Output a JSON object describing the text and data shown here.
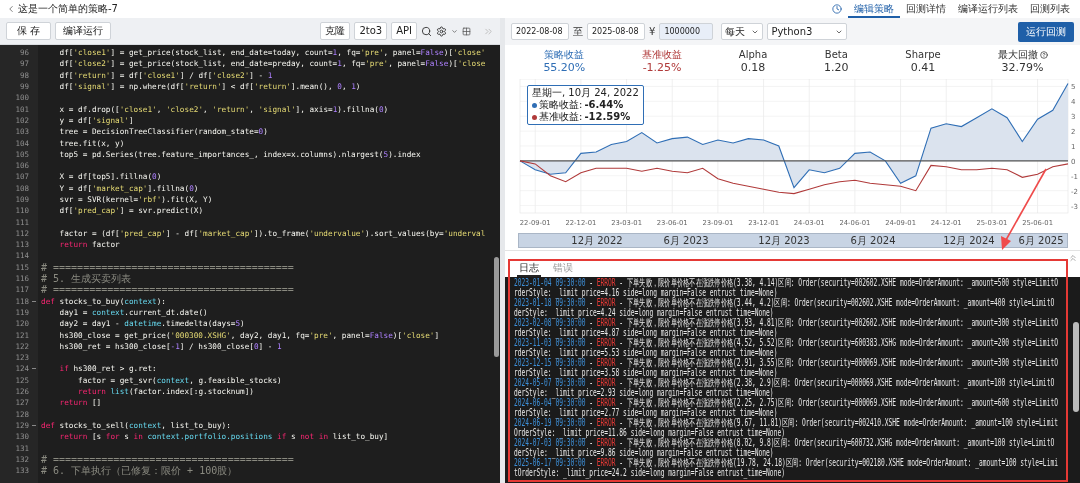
{
  "header": {
    "title": "这是一个简单的策略-7",
    "tabs": [
      {
        "label": "编辑策略",
        "selected": true
      },
      {
        "label": "回测详情",
        "selected": false
      },
      {
        "label": "编译运行列表",
        "selected": false
      },
      {
        "label": "回测列表",
        "selected": false
      }
    ]
  },
  "toolbar": {
    "save": "保 存",
    "compile": "编译运行",
    "tools": [
      "克隆",
      "2to3",
      "API"
    ]
  },
  "backtest": {
    "start_date": "2022-08-08",
    "range_sep": "至",
    "end_date": "2025-08-08",
    "currency": "¥",
    "capital": "1000000",
    "frequency": "每天",
    "language": "Python3",
    "run": "运行回测"
  },
  "code_lines": [
    {
      "num": "96",
      "fold": false,
      "tokens": [
        {
          "text": "    df[",
          "kind": "plain"
        },
        {
          "text": "'close1'",
          "kind": "string"
        },
        {
          "text": "] = get_price(stock_list, end_date=today, count=",
          "kind": "plain"
        },
        {
          "text": "1",
          "kind": "number"
        },
        {
          "text": ", fq=",
          "kind": "plain"
        },
        {
          "text": "'pre'",
          "kind": "string"
        },
        {
          "text": ", panel=",
          "kind": "plain"
        },
        {
          "text": "False",
          "kind": "number"
        },
        {
          "text": ")[",
          "kind": "plain"
        },
        {
          "text": "'close'",
          "kind": "string"
        }
      ]
    },
    {
      "num": "97",
      "fold": false,
      "tokens": [
        {
          "text": "    df[",
          "kind": "plain"
        },
        {
          "text": "'close2'",
          "kind": "string"
        },
        {
          "text": "] = get_price(stock_list, end_date=preday, count=",
          "kind": "plain"
        },
        {
          "text": "1",
          "kind": "number"
        },
        {
          "text": ", fq=",
          "kind": "plain"
        },
        {
          "text": "'pre'",
          "kind": "string"
        },
        {
          "text": ", panel=",
          "kind": "plain"
        },
        {
          "text": "False",
          "kind": "number"
        },
        {
          "text": ")[",
          "kind": "plain"
        },
        {
          "text": "'close",
          "kind": "string"
        }
      ]
    },
    {
      "num": "98",
      "fold": false,
      "tokens": [
        {
          "text": "    df[",
          "kind": "plain"
        },
        {
          "text": "'return'",
          "kind": "string"
        },
        {
          "text": "] = df[",
          "kind": "plain"
        },
        {
          "text": "'close1'",
          "kind": "string"
        },
        {
          "text": "] / df[",
          "kind": "plain"
        },
        {
          "text": "'close2'",
          "kind": "string"
        },
        {
          "text": "] - ",
          "kind": "plain"
        },
        {
          "text": "1",
          "kind": "number"
        }
      ]
    },
    {
      "num": "99",
      "fold": false,
      "tokens": [
        {
          "text": "    df[",
          "kind": "plain"
        },
        {
          "text": "'signal'",
          "kind": "string"
        },
        {
          "text": "] = np.where(df[",
          "kind": "plain"
        },
        {
          "text": "'return'",
          "kind": "string"
        },
        {
          "text": "] < df[",
          "kind": "plain"
        },
        {
          "text": "'return'",
          "kind": "string"
        },
        {
          "text": "].mean(), ",
          "kind": "plain"
        },
        {
          "text": "0",
          "kind": "number"
        },
        {
          "text": ", ",
          "kind": "plain"
        },
        {
          "text": "1",
          "kind": "number"
        },
        {
          "text": ")",
          "kind": "plain"
        }
      ]
    },
    {
      "num": "100",
      "fold": false
    },
    {
      "num": "101",
      "fold": false,
      "tokens": [
        {
          "text": "    x = df.drop([",
          "kind": "plain"
        },
        {
          "text": "'close1'",
          "kind": "string"
        },
        {
          "text": ", ",
          "kind": "plain"
        },
        {
          "text": "'close2'",
          "kind": "string"
        },
        {
          "text": ", ",
          "kind": "plain"
        },
        {
          "text": "'return'",
          "kind": "string"
        },
        {
          "text": ", ",
          "kind": "plain"
        },
        {
          "text": "'signal'",
          "kind": "string"
        },
        {
          "text": "], axis=",
          "kind": "plain"
        },
        {
          "text": "1",
          "kind": "number"
        },
        {
          "text": ").fillna(",
          "kind": "plain"
        },
        {
          "text": "0",
          "kind": "number"
        },
        {
          "text": ")",
          "kind": "plain"
        }
      ]
    },
    {
      "num": "102",
      "fold": false,
      "tokens": [
        {
          "text": "    y = df[",
          "kind": "plain"
        },
        {
          "text": "'signal'",
          "kind": "string"
        },
        {
          "text": "]",
          "kind": "plain"
        }
      ]
    },
    {
      "num": "103",
      "fold": false,
      "tokens": [
        {
          "text": "    tree = DecisionTreeClassifier(random_state=",
          "kind": "plain"
        },
        {
          "text": "0",
          "kind": "number"
        },
        {
          "text": ")",
          "kind": "plain"
        }
      ]
    },
    {
      "num": "104",
      "fold": false,
      "tokens": [
        {
          "text": "    tree.fit(x, y)",
          "kind": "plain"
        }
      ]
    },
    {
      "num": "105",
      "fold": false,
      "tokens": [
        {
          "text": "    top5 = pd.Series(tree.feature_importances_, index=x.columns).nlargest(",
          "kind": "plain"
        },
        {
          "text": "5",
          "kind": "number"
        },
        {
          "text": ").index",
          "kind": "plain"
        }
      ]
    },
    {
      "num": "106",
      "fold": false
    },
    {
      "num": "107",
      "fold": false,
      "tokens": [
        {
          "text": "    X = df[top5].fillna(",
          "kind": "plain"
        },
        {
          "text": "0",
          "kind": "number"
        },
        {
          "text": ")",
          "kind": "plain"
        }
      ]
    },
    {
      "num": "108",
      "fold": false,
      "tokens": [
        {
          "text": "    Y = df[",
          "kind": "plain"
        },
        {
          "text": "'market_cap'",
          "kind": "string"
        },
        {
          "text": "].fillna(",
          "kind": "plain"
        },
        {
          "text": "0",
          "kind": "number"
        },
        {
          "text": ")",
          "kind": "plain"
        }
      ]
    },
    {
      "num": "109",
      "fold": false,
      "tokens": [
        {
          "text": "    svr = SVR(kernel=",
          "kind": "plain"
        },
        {
          "text": "'rbf'",
          "kind": "string"
        },
        {
          "text": ").fit(X, Y)",
          "kind": "plain"
        }
      ]
    },
    {
      "num": "110",
      "fold": false,
      "tokens": [
        {
          "text": "    df[",
          "kind": "plain"
        },
        {
          "text": "'pred_cap'",
          "kind": "string"
        },
        {
          "text": "] = svr.predict(X)",
          "kind": "plain"
        }
      ]
    },
    {
      "num": "111",
      "fold": false
    },
    {
      "num": "112",
      "fold": false,
      "tokens": [
        {
          "text": "    factor = (df[",
          "kind": "plain"
        },
        {
          "text": "'pred_cap'",
          "kind": "string"
        },
        {
          "text": "] - df[",
          "kind": "plain"
        },
        {
          "text": "'market_cap'",
          "kind": "string"
        },
        {
          "text": "]).to_frame(",
          "kind": "plain"
        },
        {
          "text": "'undervalue'",
          "kind": "string"
        },
        {
          "text": ").sort_values(by=",
          "kind": "plain"
        },
        {
          "text": "'underval",
          "kind": "string"
        }
      ]
    },
    {
      "num": "113",
      "fold": false,
      "tokens": [
        {
          "text": "    return",
          "kind": "keyword"
        },
        {
          "text": " factor",
          "kind": "plain"
        }
      ]
    },
    {
      "num": "114",
      "fold": false
    },
    {
      "num": "115",
      "fold": false,
      "tokens": [
        {
          "text": "# ========================================",
          "kind": "comment"
        }
      ]
    },
    {
      "num": "116",
      "fold": false,
      "tokens": [
        {
          "text": "# 5. 生成买卖列表",
          "kind": "comment"
        }
      ]
    },
    {
      "num": "117",
      "fold": false,
      "tokens": [
        {
          "text": "# ========================================",
          "kind": "comment"
        }
      ]
    },
    {
      "num": "118",
      "fold": true,
      "tokens": [
        {
          "text": "def",
          "kind": "keyword"
        },
        {
          "text": " stocks_to_buy(",
          "kind": "plain"
        },
        {
          "text": "context",
          "kind": "builtin"
        },
        {
          "text": "):",
          "kind": "plain"
        }
      ]
    },
    {
      "num": "119",
      "fold": false,
      "tokens": [
        {
          "text": "    day1 = ",
          "kind": "plain"
        },
        {
          "text": "context",
          "kind": "builtin"
        },
        {
          "text": ".current_dt.date()",
          "kind": "plain"
        }
      ]
    },
    {
      "num": "120",
      "fold": false,
      "tokens": [
        {
          "text": "    day2 = day1 - ",
          "kind": "plain"
        },
        {
          "text": "datetime",
          "kind": "builtin"
        },
        {
          "text": ".timedelta(days=",
          "kind": "plain"
        },
        {
          "text": "5",
          "kind": "number"
        },
        {
          "text": ")",
          "kind": "plain"
        }
      ]
    },
    {
      "num": "121",
      "fold": false,
      "tokens": [
        {
          "text": "    hs300_close = get_price(",
          "kind": "plain"
        },
        {
          "text": "'000300.XSHG'",
          "kind": "string"
        },
        {
          "text": ", day2, day1, fq=",
          "kind": "plain"
        },
        {
          "text": "'pre'",
          "kind": "string"
        },
        {
          "text": ", panel=",
          "kind": "plain"
        },
        {
          "text": "False",
          "kind": "number"
        },
        {
          "text": ")[",
          "kind": "plain"
        },
        {
          "text": "'close'",
          "kind": "string"
        },
        {
          "text": "]",
          "kind": "plain"
        }
      ]
    },
    {
      "num": "122",
      "fold": false,
      "tokens": [
        {
          "text": "    hs300_ret = hs300_close[",
          "kind": "plain"
        },
        {
          "text": "-1",
          "kind": "number"
        },
        {
          "text": "] / hs300_close[",
          "kind": "plain"
        },
        {
          "text": "0",
          "kind": "number"
        },
        {
          "text": "] - ",
          "kind": "plain"
        },
        {
          "text": "1",
          "kind": "number"
        }
      ]
    },
    {
      "num": "123",
      "fold": false
    },
    {
      "num": "124",
      "fold": true,
      "tokens": [
        {
          "text": "    if",
          "kind": "keyword"
        },
        {
          "text": " hs300_ret > g.ret:",
          "kind": "plain"
        }
      ]
    },
    {
      "num": "125",
      "fold": false,
      "tokens": [
        {
          "text": "        factor = get_svr(",
          "kind": "plain"
        },
        {
          "text": "context",
          "kind": "builtin"
        },
        {
          "text": ", g.feasible_stocks)",
          "kind": "plain"
        }
      ]
    },
    {
      "num": "126",
      "fold": false,
      "tokens": [
        {
          "text": "        return",
          "kind": "keyword"
        },
        {
          "text": " list",
          "kind": "builtin"
        },
        {
          "text": "(factor.index[:g.stocknum])",
          "kind": "plain"
        }
      ]
    },
    {
      "num": "127",
      "fold": false,
      "tokens": [
        {
          "text": "    return",
          "kind": "keyword"
        },
        {
          "text": " []",
          "kind": "plain"
        }
      ]
    },
    {
      "num": "128",
      "fold": false
    },
    {
      "num": "129",
      "fold": true,
      "tokens": [
        {
          "text": "def",
          "kind": "keyword"
        },
        {
          "text": " stocks_to_sell(",
          "kind": "plain"
        },
        {
          "text": "context",
          "kind": "builtin"
        },
        {
          "text": ", list_to_buy):",
          "kind": "plain"
        }
      ]
    },
    {
      "num": "130",
      "fold": false,
      "tokens": [
        {
          "text": "    return",
          "kind": "keyword"
        },
        {
          "text": " [s ",
          "kind": "plain"
        },
        {
          "text": "for",
          "kind": "keyword"
        },
        {
          "text": " s ",
          "kind": "plain"
        },
        {
          "text": "in",
          "kind": "keyword"
        },
        {
          "text": " context.portfolio.positions",
          "kind": "builtin"
        },
        {
          "text": " if",
          "kind": "keyword"
        },
        {
          "text": " s ",
          "kind": "plain"
        },
        {
          "text": "not in",
          "kind": "keyword"
        },
        {
          "text": " list_to_buy]",
          "kind": "plain"
        }
      ]
    },
    {
      "num": "131",
      "fold": false
    },
    {
      "num": "132",
      "fold": false,
      "tokens": [
        {
          "text": "# ========================================",
          "kind": "comment"
        }
      ]
    },
    {
      "num": "133",
      "fold": false,
      "tokens": [
        {
          "text": "# 6. 下单执行（已修复：限价 + 100股）",
          "kind": "comment"
        }
      ]
    }
  ],
  "stats": [
    {
      "label": "策略收益",
      "value": "55.20%",
      "color": "#2f6eb5"
    },
    {
      "label": "基准收益",
      "value": "-1.25%",
      "color": "#b03a3a"
    },
    {
      "label": "Alpha",
      "value": "0.18",
      "color": "#333333"
    },
    {
      "label": "Beta",
      "value": "1.20",
      "color": "#333333"
    },
    {
      "label": "Sharpe",
      "value": "0.41",
      "color": "#333333"
    },
    {
      "label": "最大回撤",
      "value": "32.79%",
      "color": "#333333"
    }
  ],
  "chart": {
    "chart_data": {
      "type": "line",
      "categories": [
        null,
        "22-09-01",
        null,
        null,
        "22-12-01",
        null,
        null,
        "23-03-01",
        null,
        null,
        "23-06-01",
        null,
        null,
        "23-09-01",
        null,
        null,
        "23-12-01",
        null,
        null,
        "24-03-01",
        null,
        null,
        "24-06-01",
        null,
        null,
        "24-09-01",
        null,
        null,
        "24-12-01",
        null,
        null,
        "25-03-01",
        null,
        null,
        "25-06-01",
        null,
        null
      ],
      "series": [
        {
          "color": "#2f6eb5",
          "values": [
            0,
            -0.6,
            -0.9,
            -0.8,
            0.5,
            0.6,
            1.1,
            1.3,
            1.9,
            1.2,
            1.5,
            1.6,
            1.1,
            1.4,
            1.2,
            1.5,
            1.4,
            1.0,
            -1.8,
            -0.6,
            -0.8,
            -0.5,
            0.5,
            0.6,
            0,
            -1.5,
            -1.0,
            2.2,
            2.5,
            2.3,
            2.9,
            3.5,
            2.9,
            1.3,
            2.8,
            3.4,
            5.2
          ]
        },
        {
          "color": "#b03a3a",
          "values": [
            0,
            -0.2,
            -1.0,
            -1.4,
            -0.8,
            -0.5,
            -0.5,
            -0.5,
            -0.7,
            -0.5,
            -0.7,
            -0.8,
            -0.5,
            -1.2,
            -1.5,
            -1.7,
            -1.9,
            -2.1,
            -2.2,
            -1.9,
            -1.6,
            -1.4,
            -1.3,
            -1.5,
            -1.6,
            -1.7,
            -2.0,
            -0.3,
            -0.4,
            -0.6,
            -0.6,
            -0.5,
            -0.6,
            -1.1,
            -0.9,
            -0.4,
            -0.2
          ]
        }
      ],
      "ylim": [
        -3.5,
        5.5
      ],
      "yticks": [
        5,
        4,
        3,
        2,
        1,
        0,
        -1,
        -2,
        -3
      ],
      "grid": true
    },
    "tooltip": {
      "date": "星期一, 10月 24, 2022",
      "rows": [
        {
          "label": "策略收益:",
          "value": "-6.44%",
          "color": "#2f6eb5"
        },
        {
          "label": "基准收益:",
          "value": "-12.59%",
          "color": "#b03a3a"
        }
      ]
    },
    "navigator": [
      "12月 2022",
      "6月 2023",
      "12月 2023",
      "6月 2024",
      "12月 2024",
      "6月 2025"
    ]
  },
  "log": {
    "tabs": [
      {
        "label": "日志",
        "selected": true
      },
      {
        "label": "错误",
        "selected": false
      }
    ],
    "entries": [
      {
        "time": "2023-01-04 09:30:00",
        "sep": "-",
        "level": "ERROR",
        "message": "- 下单失败，限价单价格不在涨跌停价格(3.38, 4.14)区间: Order(security=002602.XSHE mode=OrderAmount: _amount=500 style=LimitO",
        "continuation": "rderStyle: _limit_price=4.16 side=long margin=False entrust_time=None)"
      },
      {
        "time": "2023-01-18 09:30:00",
        "sep": "-",
        "level": "ERROR",
        "message": "- 下单失败，限价单价格不在涨跌停价格(3.44, 4.2)区间: Order(security=002602.XSHE mode=OrderAmount: _amount=400 style=LimitO",
        "continuation": "derStyle: _limit_price=4.24 side=long margin=False entrust_time=None)"
      },
      {
        "time": "2023-02-08 09:30:00",
        "sep": "-",
        "level": "ERROR",
        "message": "- 下单失败，限价单价格不在涨跌停价格(3.93, 4.81)区间: Order(security=002602.XSHE mode=OrderAmount: _amount=300 style=LimitO",
        "continuation": "rderStyle: _limit_price=4.87 side=long margin=False entrust_time=None)"
      },
      {
        "time": "2023-11-03 09:30:00",
        "sep": "-",
        "level": "ERROR",
        "message": "- 下单失败，限价单价格不在涨跌停价格(4.52, 5.52)区间: Order(security=600383.XSHG mode=OrderAmount: _amount=200 style=LimitO",
        "continuation": "rderStyle: _limit_price=5.53 side=long margin=False entrust_time=None)"
      },
      {
        "time": "2023-12-15 09:30:00",
        "sep": "-",
        "level": "ERROR",
        "message": "- 下单失败，限价单价格不在涨跌停价格(2.91, 3.55)区间: Order(security=000069.XSHE mode=OrderAmount: _amount=300 style=LimitO",
        "continuation": "rderStyle: _limit_price=3.58 side=long margin=False entrust_time=None)"
      },
      {
        "time": "2024-05-07 09:30:00",
        "sep": "-",
        "level": "ERROR",
        "message": "- 下单失败，限价单价格不在涨跌停价格(2.38, 2.9)区间: Order(security=000069.XSHE mode=OrderAmount: _amount=100 style=LimitO",
        "continuation": "derStyle: _limit_price=2.93 side=long margin=False entrust_time=None)"
      },
      {
        "time": "2024-06-04 09:30:00",
        "sep": "-",
        "level": "ERROR",
        "message": "- 下单失败，限价单价格不在涨跌停价格(2.25, 2.75)区间: Order(security=000069.XSHE mode=OrderAmount: _amount=600 style=LimitO",
        "continuation": "rderStyle: _limit_price=2.77 side=long margin=False entrust_time=None)"
      },
      {
        "time": "2024-06-19 09:30:00",
        "sep": "-",
        "level": "ERROR",
        "message": "- 下单失败，限价单价格不在涨跌停价格(9.67, 11.81)区间: Order(security=002410.XSHE mode=OrderAmount: _amount=100 style=Limit",
        "continuation": "OrderStyle: _limit_price=11.86 side=long margin=False entrust_time=None)"
      },
      {
        "time": "2024-07-03 09:30:00",
        "sep": "-",
        "level": "ERROR",
        "message": "- 下单失败，限价单价格不在涨跌停价格(8.02, 9.8)区间: Order(security=600732.XSHG mode=OrderAmount: _amount=100 style=LimitO",
        "continuation": "derStyle: _limit_price=9.86 side=long margin=False entrust_time=None)"
      },
      {
        "time": "2025-06-17 09:30:00",
        "sep": "-",
        "level": "ERROR",
        "message": "- 下单失败，限价单价格不在涨跌停价格(19.78, 24.18)区间: Order(security=002180.XSHE mode=OrderAmount: _amount=100 style=Limi",
        "continuation": "tOrderStyle: _limit_price=24.2 side=long margin=False entrust_time=None)"
      }
    ]
  }
}
